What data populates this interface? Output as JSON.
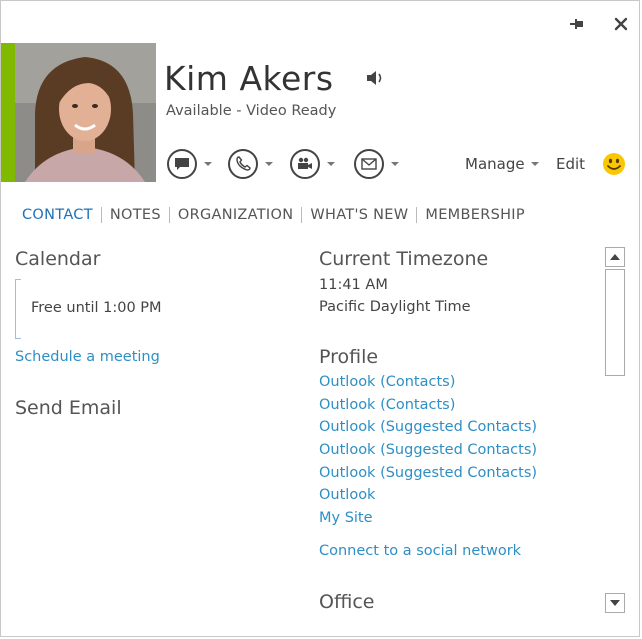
{
  "window": {
    "pin_icon": "pin-icon",
    "close_icon": "close-icon"
  },
  "contact": {
    "name": "Kim Akers",
    "status": "Available - Video Ready",
    "presence_color": "#7fba00"
  },
  "actions": {
    "manage_label": "Manage",
    "edit_label": "Edit"
  },
  "tabs": [
    {
      "label": "CONTACT",
      "active": true
    },
    {
      "label": "NOTES"
    },
    {
      "label": "ORGANIZATION"
    },
    {
      "label": "WHAT'S NEW"
    },
    {
      "label": "MEMBERSHIP"
    }
  ],
  "calendar": {
    "heading": "Calendar",
    "free_text": "Free until 1:00 PM",
    "schedule_link": "Schedule a meeting"
  },
  "send_email": {
    "heading": "Send Email"
  },
  "timezone": {
    "heading": "Current Timezone",
    "time": "11:41 AM",
    "zone": "Pacific Daylight Time"
  },
  "profile": {
    "heading": "Profile",
    "links": [
      "Outlook (Contacts)",
      "Outlook (Contacts)",
      "Outlook (Suggested Contacts)",
      "Outlook (Suggested Contacts)",
      "Outlook (Suggested Contacts)",
      "Outlook",
      "My Site"
    ],
    "social_link": "Connect to a social network"
  },
  "office": {
    "heading": "Office"
  },
  "colors": {
    "accent": "#2072b8",
    "link": "#2e8fc4",
    "smiley": "#f9c802"
  }
}
